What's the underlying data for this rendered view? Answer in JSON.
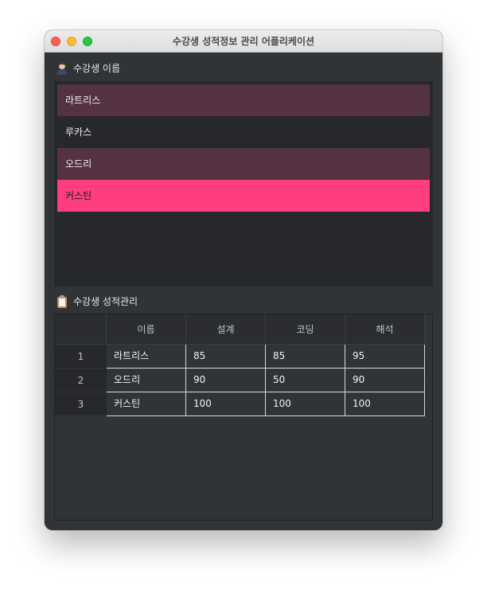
{
  "window": {
    "title": "수강생 성적정보 관리 어플리케이션"
  },
  "students_section": {
    "label": "수강생 이름",
    "icon": "person-icon",
    "items": [
      {
        "name": "라트리스",
        "state": "alternate"
      },
      {
        "name": "루카스",
        "state": "normal"
      },
      {
        "name": "오드리",
        "state": "alternate"
      },
      {
        "name": "커스틴",
        "state": "selected"
      }
    ]
  },
  "grades_section": {
    "label": "수강생 성적관리",
    "icon": "clipboard-icon",
    "columns": [
      "이름",
      "설계",
      "코딩",
      "해석"
    ],
    "rows": [
      {
        "index": "1",
        "cells": [
          "라트리스",
          "85",
          "85",
          "95"
        ]
      },
      {
        "index": "2",
        "cells": [
          "오드리",
          "90",
          "50",
          "90"
        ]
      },
      {
        "index": "3",
        "cells": [
          "커스틴",
          "100",
          "100",
          "100"
        ]
      }
    ]
  },
  "colors": {
    "window_bg": "#313437",
    "list_bg": "#26282c",
    "alternate_row": "#553241",
    "selected_row": "#ff3e7f"
  }
}
